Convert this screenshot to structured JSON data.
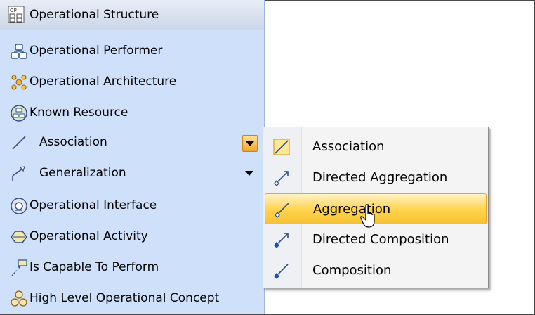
{
  "palette": {
    "header": {
      "label": "Operational Structure",
      "icon": "op-structure-icon"
    },
    "items": [
      {
        "label": "Operational Performer",
        "icon": "operational-performer-icon"
      },
      {
        "label": "Operational Architecture",
        "icon": "operational-architecture-icon"
      },
      {
        "label": "Known Resource",
        "icon": "known-resource-icon"
      },
      {
        "label": "Association",
        "icon": "association-line-icon",
        "has_dropdown": true,
        "dropdown_active": true
      },
      {
        "label": "Generalization",
        "icon": "generalization-icon",
        "has_dropdown": true,
        "dropdown_active": false
      },
      {
        "label": "Operational Interface",
        "icon": "operational-interface-icon"
      },
      {
        "label": "Operational Activity",
        "icon": "operational-activity-icon"
      },
      {
        "label": "Is Capable To Perform",
        "icon": "is-capable-to-perform-icon"
      },
      {
        "label": "High Level Operational Concept",
        "icon": "high-level-concept-icon"
      }
    ]
  },
  "popup_menu": {
    "items": [
      {
        "label": "Association",
        "icon": "association-icon"
      },
      {
        "label": "Directed Aggregation",
        "icon": "directed-aggregation-icon"
      },
      {
        "label": "Aggregation",
        "icon": "aggregation-icon",
        "selected": true
      },
      {
        "label": "Directed Composition",
        "icon": "directed-composition-icon"
      },
      {
        "label": "Composition",
        "icon": "composition-icon"
      }
    ]
  },
  "colors": {
    "palette_bg": "#cfe0fb",
    "selection": "#ffd24a",
    "dropdown_button": "#f0a52b"
  }
}
